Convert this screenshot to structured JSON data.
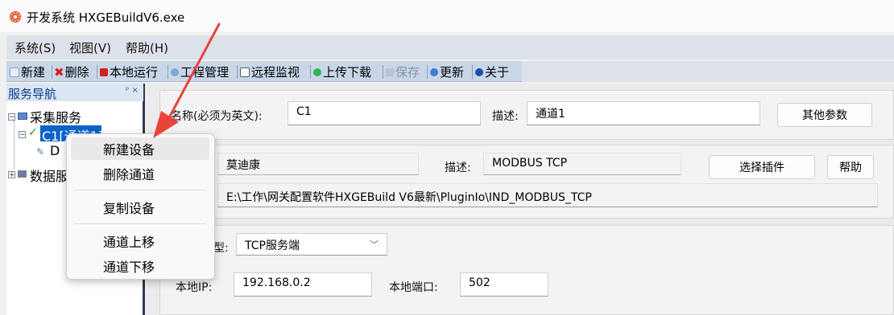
{
  "window": {
    "title": "开发系统 HXGEBuildV6.exe"
  },
  "menubar": {
    "items": [
      "系统(S)",
      "视图(V)",
      "帮助(H)"
    ]
  },
  "toolbar": {
    "buttons": [
      {
        "label": "新建",
        "icon": "new-icon"
      },
      {
        "label": "删除",
        "icon": "delete-icon"
      },
      {
        "label": "本地运行",
        "icon": "run-icon"
      },
      {
        "label": "工程管理",
        "icon": "project-icon"
      },
      {
        "label": "远程监视",
        "icon": "monitor-icon"
      },
      {
        "label": "上传下载",
        "icon": "upload-icon"
      },
      {
        "label": "保存",
        "icon": "save-icon"
      },
      {
        "label": "更新",
        "icon": "update-icon"
      },
      {
        "label": "关于",
        "icon": "about-icon"
      }
    ]
  },
  "nav": {
    "title": "服务导航",
    "pin": "ᵖ ×",
    "tree": {
      "collect": "采集服务",
      "channel": "C1[通道1]",
      "device": "D",
      "data": "数据服"
    }
  },
  "channel_form": {
    "name_label": "名称(必须为英文):",
    "name_value": "C1",
    "desc_label": "描述:",
    "desc_value": "通道1",
    "other_btn": "其他参数"
  },
  "plugin_form": {
    "vendor_value": "莫迪康",
    "desc_label": "描述:",
    "desc_value": "MODBUS TCP",
    "select_btn": "选择插件",
    "help_btn": "帮助",
    "path_value": "E:\\工作\\网关配置软件HXGEBuild V6最新\\PluginIo\\IND_MODBUS_TCP"
  },
  "comm_form": {
    "type_label_tail": "型:",
    "type_value": "TCP服务端",
    "ip_label": "本地IP:",
    "ip_value": "192.168.0.2",
    "port_label": "本地端口:",
    "port_value": "502"
  },
  "context_menu": {
    "items": [
      "新建设备",
      "删除通道",
      "复制设备",
      "通道上移",
      "通道下移"
    ]
  },
  "colors": {
    "accent_arrow": "#e8443a",
    "selection": "#0a63c9",
    "toolbar_bg": "#c9d6e8"
  }
}
